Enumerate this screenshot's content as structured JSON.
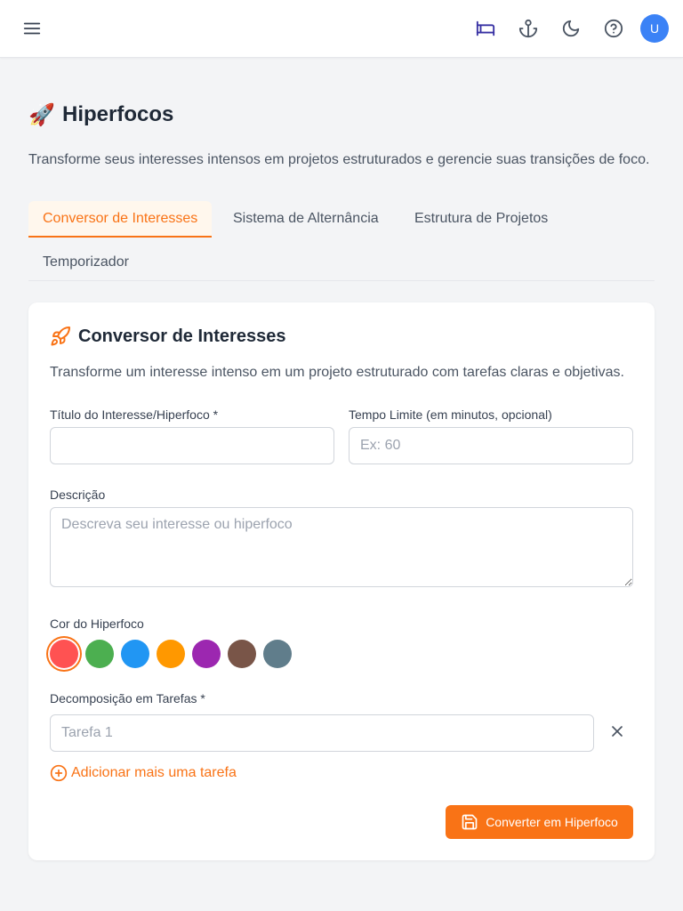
{
  "topbar": {
    "menu_icon": "hamburger-menu-icon",
    "actions": [
      {
        "icon": "bed-icon",
        "color": "#3730a3"
      },
      {
        "icon": "anchor-icon",
        "color": "#4b5563"
      },
      {
        "icon": "moon-icon",
        "color": "#4b5563"
      },
      {
        "icon": "help-circle-icon",
        "color": "#4b5563"
      }
    ],
    "avatar_initial": "U",
    "avatar_color": "#3b82f6"
  },
  "page": {
    "emoji": "🚀",
    "title": "Hiperfocos",
    "subtitle": "Transforme seus interesses intensos em projetos estruturados e gerencie suas transições de foco."
  },
  "tabs": [
    {
      "label": "Conversor de Interesses",
      "active": true
    },
    {
      "label": "Sistema de Alternância",
      "active": false
    },
    {
      "label": "Estrutura de Projetos",
      "active": false
    },
    {
      "label": "Temporizador",
      "active": false
    }
  ],
  "card": {
    "icon": "rocket-icon",
    "title": "Conversor de Interesses",
    "description": "Transforme um interesse intenso em um projeto estruturado com tarefas claras e objetivas.",
    "fields": {
      "title_label": "Título do Interesse/Hiperfoco *",
      "title_value": "",
      "time_label": "Tempo Limite (em minutos, opcional)",
      "time_placeholder": "Ex: 60",
      "desc_label": "Descrição",
      "desc_placeholder": "Descreva seu interesse ou hiperfoco",
      "color_label": "Cor do Hiperfoco",
      "tasks_label": "Decomposição em Tarefas *",
      "task_placeholder": "Tarefa 1"
    },
    "colors": [
      "#ff5252",
      "#4caf50",
      "#2196f3",
      "#ff9800",
      "#9c27b0",
      "#795548",
      "#607d8b"
    ],
    "selected_color": "#ff5252",
    "add_task_label": "Adicionar mais uma tarefa",
    "submit_label": "Converter em Hiperfoco"
  },
  "colors": {
    "accent": "#f97316",
    "accent_bg": "#fff7ed"
  }
}
